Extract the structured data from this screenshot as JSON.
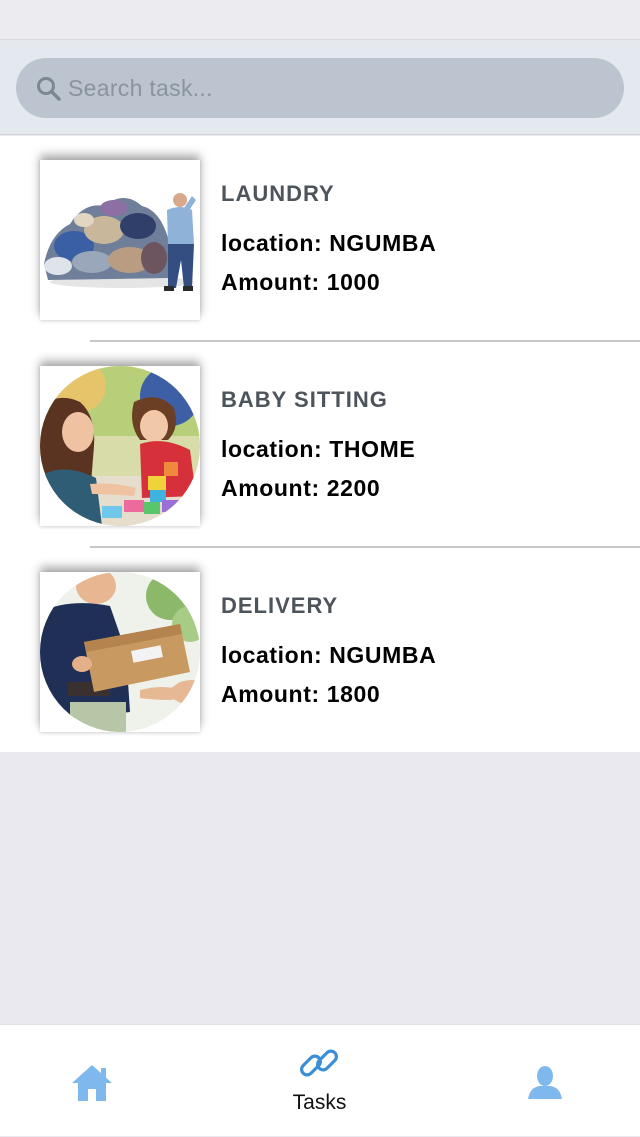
{
  "search": {
    "placeholder": "Search task..."
  },
  "tasks": [
    {
      "title": "LAUNDRY",
      "location": "location: NGUMBA",
      "amount": "Amount: 1000",
      "image_icon": "laundry-photo"
    },
    {
      "title": "BABY SITTING",
      "location": "location: THOME",
      "amount": "Amount: 2200",
      "image_icon": "baby-sitting-photo"
    },
    {
      "title": "DELIVERY",
      "location": "location: NGUMBA",
      "amount": "Amount: 1800",
      "image_icon": "delivery-photo"
    }
  ],
  "tabs": [
    {
      "icon": "home-icon",
      "label": ""
    },
    {
      "icon": "link-icon",
      "label": "Tasks"
    },
    {
      "icon": "profile-icon",
      "label": ""
    }
  ],
  "colors": {
    "accent": "#3b8fd6",
    "tab_icon_inactive": "#7fb8ec",
    "search_field": "#bcc5cf",
    "background": "#e9e9ef"
  }
}
